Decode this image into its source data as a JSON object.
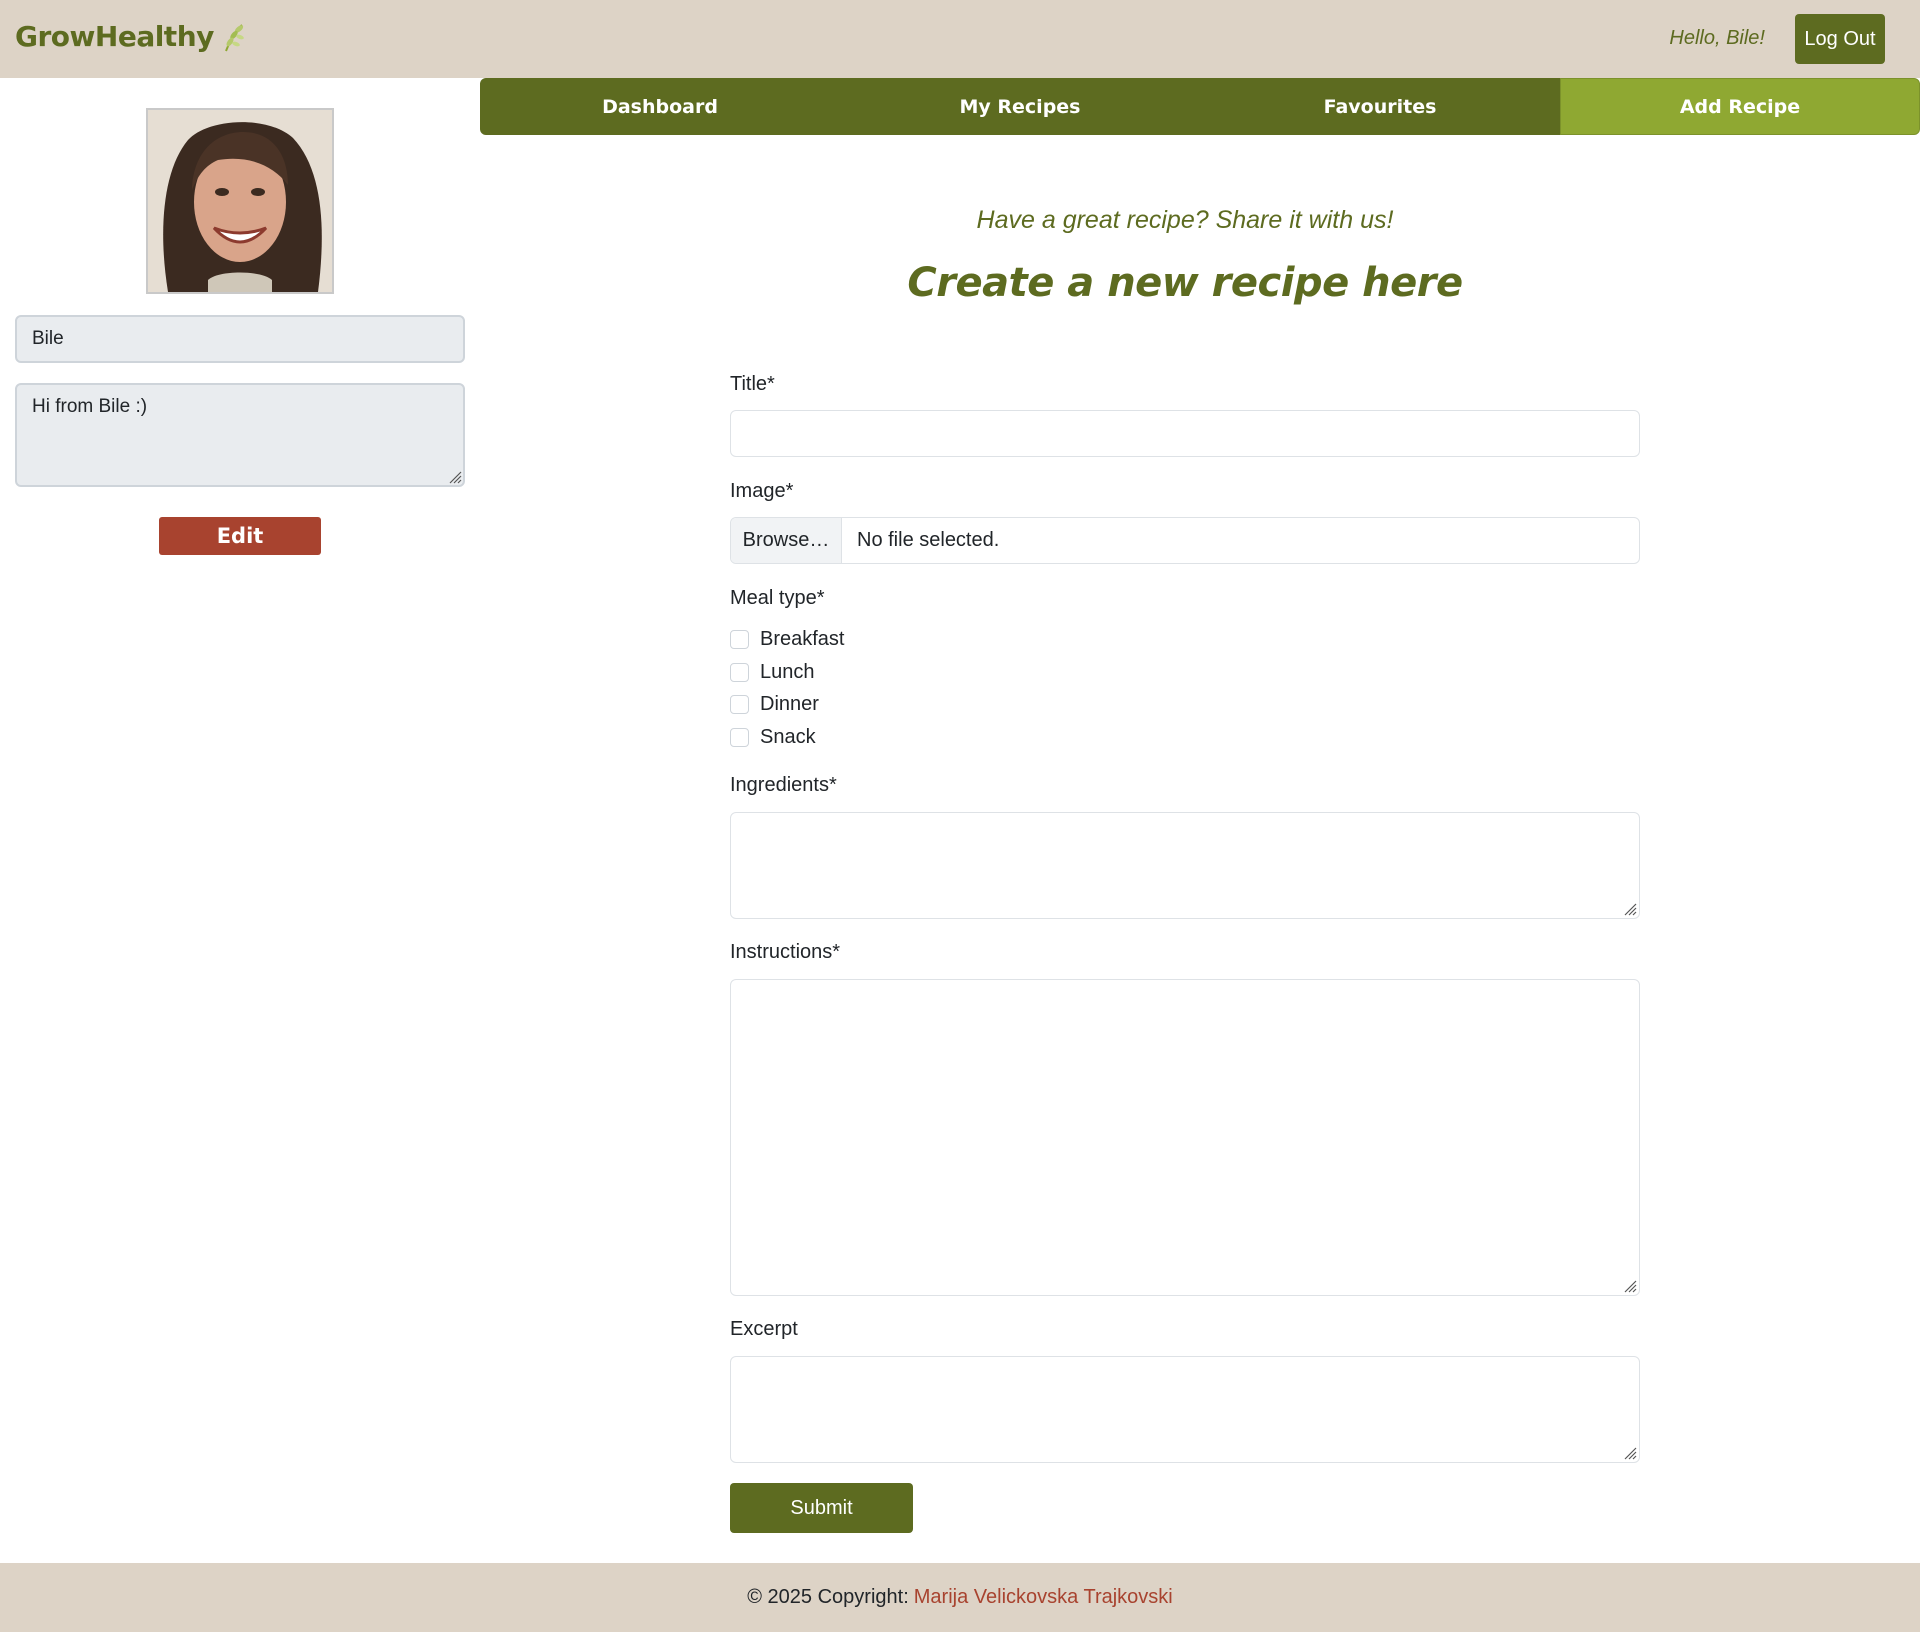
{
  "header": {
    "brand": "GrowHealthy",
    "brand_icon": "leaf-icon",
    "greeting": "Hello, Bile!",
    "logout_label": "Log Out"
  },
  "sidebar": {
    "name_value": "Bile",
    "bio_value": "Hi from Bile :)",
    "edit_label": "Edit"
  },
  "nav": {
    "tabs": [
      {
        "label": "Dashboard",
        "active": false
      },
      {
        "label": "My Recipes",
        "active": false
      },
      {
        "label": "Favourites",
        "active": false
      },
      {
        "label": "Add Recipe",
        "active": true
      }
    ]
  },
  "form": {
    "tagline": "Have a great recipe? Share it with us!",
    "title": "Create a new recipe here",
    "title_label": "Title*",
    "title_value": "",
    "image_label": "Image*",
    "browse_label": "Browse…",
    "file_status": "No file selected.",
    "meal_type_label": "Meal type*",
    "meal_types": [
      "Breakfast",
      "Lunch",
      "Dinner",
      "Snack"
    ],
    "ingredients_label": "Ingredients*",
    "ingredients_value": "",
    "instructions_label": "Instructions*",
    "instructions_value": "",
    "excerpt_label": "Excerpt",
    "excerpt_value": "",
    "submit_label": "Submit"
  },
  "footer": {
    "copyright": "© 2025 Copyright:",
    "author": "Marija Velickovska Trajkovski"
  },
  "colors": {
    "brand_green": "#5d6b20",
    "active_tab": "#8fa832",
    "header_bg": "#ddd3c6",
    "edit_button": "#a8432f",
    "author_link": "#a8432f"
  }
}
